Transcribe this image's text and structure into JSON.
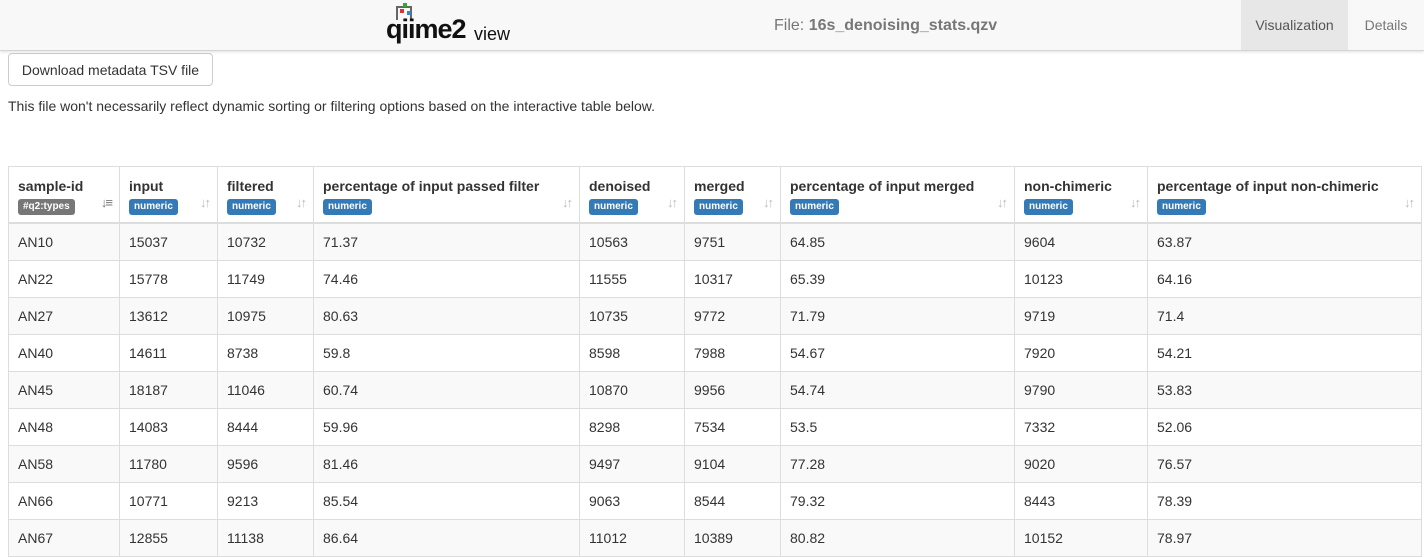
{
  "header": {
    "logo_text": "qiime2",
    "logo_view": "view",
    "file_prefix": "File:",
    "file_name": "16s_denoising_stats.qzv",
    "tabs": [
      {
        "label": "Visualization",
        "active": true
      },
      {
        "label": "Details",
        "active": false
      }
    ]
  },
  "download_button": "Download metadata TSV file",
  "note": "This file won't necessarily reflect dynamic sorting or filtering options based on the interactive table below.",
  "table": {
    "columns": [
      {
        "title": "sample-id",
        "badge": "#q2:types",
        "badge_color": "#777777"
      },
      {
        "title": "input",
        "badge": "numeric",
        "badge_color": "#337ab7"
      },
      {
        "title": "filtered",
        "badge": "numeric",
        "badge_color": "#337ab7"
      },
      {
        "title": "percentage of input passed filter",
        "badge": "numeric",
        "badge_color": "#337ab7"
      },
      {
        "title": "denoised",
        "badge": "numeric",
        "badge_color": "#337ab7"
      },
      {
        "title": "merged",
        "badge": "numeric",
        "badge_color": "#337ab7"
      },
      {
        "title": "percentage of input merged",
        "badge": "numeric",
        "badge_color": "#337ab7"
      },
      {
        "title": "non-chimeric",
        "badge": "numeric",
        "badge_color": "#337ab7"
      },
      {
        "title": "percentage of input non-chimeric",
        "badge": "numeric",
        "badge_color": "#337ab7"
      }
    ],
    "rows": [
      [
        "AN10",
        "15037",
        "10732",
        "71.37",
        "10563",
        "9751",
        "64.85",
        "9604",
        "63.87"
      ],
      [
        "AN22",
        "15778",
        "11749",
        "74.46",
        "11555",
        "10317",
        "65.39",
        "10123",
        "64.16"
      ],
      [
        "AN27",
        "13612",
        "10975",
        "80.63",
        "10735",
        "9772",
        "71.79",
        "9719",
        "71.4"
      ],
      [
        "AN40",
        "14611",
        "8738",
        "59.8",
        "8598",
        "7988",
        "54.67",
        "7920",
        "54.21"
      ],
      [
        "AN45",
        "18187",
        "11046",
        "60.74",
        "10870",
        "9956",
        "54.74",
        "9790",
        "53.83"
      ],
      [
        "AN48",
        "14083",
        "8444",
        "59.96",
        "8298",
        "7534",
        "53.5",
        "7332",
        "52.06"
      ],
      [
        "AN58",
        "11780",
        "9596",
        "81.46",
        "9497",
        "9104",
        "77.28",
        "9020",
        "76.57"
      ],
      [
        "AN66",
        "10771",
        "9213",
        "85.54",
        "9063",
        "8544",
        "79.32",
        "8443",
        "78.39"
      ],
      [
        "AN67",
        "12855",
        "11138",
        "86.64",
        "11012",
        "10389",
        "80.82",
        "10152",
        "78.97"
      ]
    ]
  }
}
